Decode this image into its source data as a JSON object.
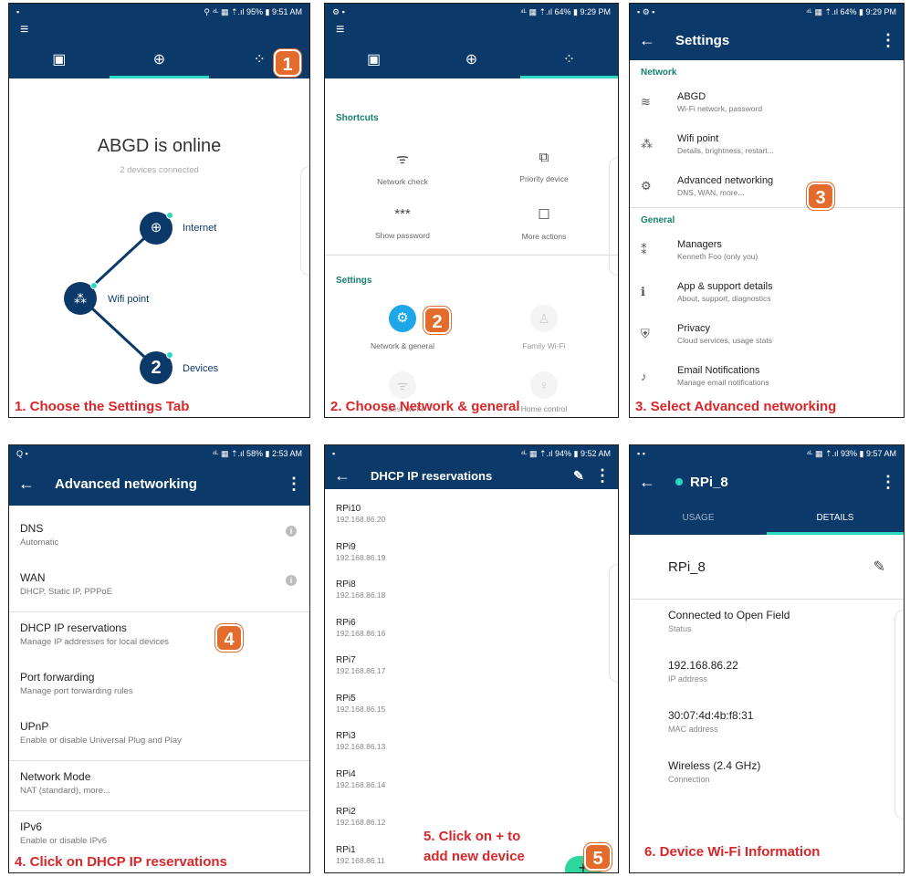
{
  "colors": {
    "navy": "#0b3a6a",
    "teal": "#2cd8c0",
    "step": "#e36b2c",
    "caption": "#d9262a"
  },
  "p1": {
    "status": {
      "left": "▪",
      "right": "⚲ ⁴ᴸ ▦ ⇡.ıl 95% ▮ 9:51 AM"
    },
    "menu_icon": "≡",
    "tabs": [
      "▣",
      "⊕",
      "⁘"
    ],
    "online_title": "ABGD is online",
    "devices_connected": "2 devices connected",
    "internet_label": "Internet",
    "wifi_point_label": "Wifi point",
    "devices_label": "Devices",
    "devices_count": "2",
    "step": "1",
    "caption": "1. Choose the Settings Tab"
  },
  "p2": {
    "status": {
      "left": "⚙ ▪",
      "right": "⁴ᴸ ▦ ⇡.ıl 64% ▮ 9:29 PM"
    },
    "menu_icon": "≡",
    "tabs": [
      "▣",
      "⊕",
      "⁘"
    ],
    "shortcuts_h": "Shortcuts",
    "network_check": "Network check",
    "priority_device": "Priority device",
    "show_password": "Show password",
    "more_actions": "More actions",
    "settings_h": "Settings",
    "network_general": "Network & general",
    "family_wifi": "Family Wi-Fi",
    "guest_wifi": "Guest Wi-Fi",
    "home_control": "Home control",
    "step": "2",
    "caption": "2. Choose Network & general"
  },
  "p3": {
    "status": {
      "left": "▪ ⚙ ▪",
      "right": "⁴ᴸ ▦ ⇡.ıl 64% ▮ 9:29 PM"
    },
    "title": "Settings",
    "network_h": "Network",
    "general_h": "General",
    "items": [
      {
        "t1": "ABGD",
        "t2": "Wi-Fi network, password",
        "icon": "≋"
      },
      {
        "t1": "Wifi point",
        "t2": "Details, brightness, restart...",
        "icon": "⁂"
      },
      {
        "t1": "Advanced networking",
        "t2": "DNS, WAN, more...",
        "icon": "⚙"
      }
    ],
    "gitems": [
      {
        "t1": "Managers",
        "t2": "Kenneth Foo (only you)",
        "icon": "👥"
      },
      {
        "t1": "App & support details",
        "t2": "About, support, diagnostics",
        "icon": "ℹ"
      },
      {
        "t1": "Privacy",
        "t2": "Cloud services, usage stats",
        "icon": "⛨"
      },
      {
        "t1": "Email Notifications",
        "t2": "Manage email notifications",
        "icon": "🔔"
      }
    ],
    "step": "3",
    "caption": "3. Select Advanced networking"
  },
  "p4": {
    "status": {
      "left": "Q ▪",
      "right": "⁴ᴸ ▦ ⇡.ıl 58% ▮ 2:53 AM"
    },
    "title": "Advanced networking",
    "rows": [
      {
        "t1": "DNS",
        "t2": "Automatic"
      },
      {
        "t1": "WAN",
        "t2": "DHCP, Static IP, PPPoE"
      },
      {
        "t1": "DHCP IP reservations",
        "t2": "Manage IP addresses for local devices"
      },
      {
        "t1": "Port forwarding",
        "t2": "Manage port forwarding rules"
      },
      {
        "t1": "UPnP",
        "t2": "Enable or disable Universal Plug and Play"
      },
      {
        "t1": "Network Mode",
        "t2": "NAT (standard), more..."
      },
      {
        "t1": "IPv6",
        "t2": "Enable or disable IPv6"
      }
    ],
    "step": "4",
    "caption": "4. Click on DHCP IP reservations"
  },
  "p5": {
    "status": {
      "left": "▪",
      "right": "⁴ᴸ ▦ ⇡.ıl 94% ▮ 9:52 AM"
    },
    "title": "DHCP IP reservations",
    "rows": [
      {
        "t1": "RPi10",
        "t2": "192.168.86.20"
      },
      {
        "t1": "RPi9",
        "t2": "192.168.86.19"
      },
      {
        "t1": "RPi8",
        "t2": "192.168.86.18"
      },
      {
        "t1": "RPi6",
        "t2": "192.168.86.16"
      },
      {
        "t1": "RPi7",
        "t2": "192.168.86.17"
      },
      {
        "t1": "RPi5",
        "t2": "192.168.86.15"
      },
      {
        "t1": "RPi3",
        "t2": "192.168.86.13"
      },
      {
        "t1": "RPi4",
        "t2": "192.168.86.14"
      },
      {
        "t1": "RPi2",
        "t2": "192.168.86.12"
      },
      {
        "t1": "RPi1",
        "t2": "192.168.86.11"
      }
    ],
    "fab": "+",
    "step": "5",
    "caption_l1": "5. Click on + to",
    "caption_l2": "add new device"
  },
  "p6": {
    "status": {
      "left": "▪ ▪",
      "right": "⁴ᴸ ▦ ⇡.ıl 93% ▮ 9:57 AM"
    },
    "title": "RPi_8",
    "tab_usage": "USAGE",
    "tab_details": "DETAILS",
    "device_name": "RPi_8",
    "rows": [
      {
        "t1": "Connected to Open Field",
        "t2": "Status"
      },
      {
        "t1": "192.168.86.22",
        "t2": "IP address"
      },
      {
        "t1": "30:07:4d:4b:f8:31",
        "t2": "MAC address"
      },
      {
        "t1": "Wireless (2.4 GHz)",
        "t2": "Connection"
      }
    ],
    "caption": "6. Device Wi-Fi Information"
  }
}
